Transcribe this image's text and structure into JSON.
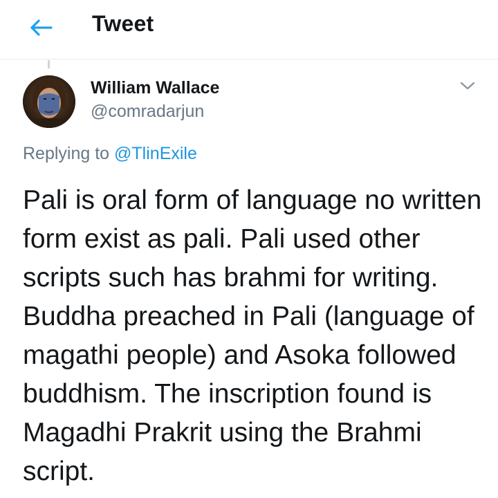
{
  "header": {
    "title": "Tweet",
    "back_icon": "arrow-left-icon",
    "accent": "#1da1f2"
  },
  "tweet": {
    "author": {
      "name": "William Wallace",
      "handle": "@comradarjun",
      "avatar_icon": "user-avatar-portrait"
    },
    "menu_icon": "chevron-down-icon",
    "reply": {
      "prefix": "Replying to",
      "mention": "@TlinExile",
      "mention_color": "#1b95e0"
    },
    "text": "Pali is oral form of language no written form exist as pali. Pali used other scripts such has brahmi for writing. Buddha preached in Pali (language of magathi people) and Asoka followed buddhism. The inscription found is Magadhi Prakrit using the Brahmi script."
  }
}
